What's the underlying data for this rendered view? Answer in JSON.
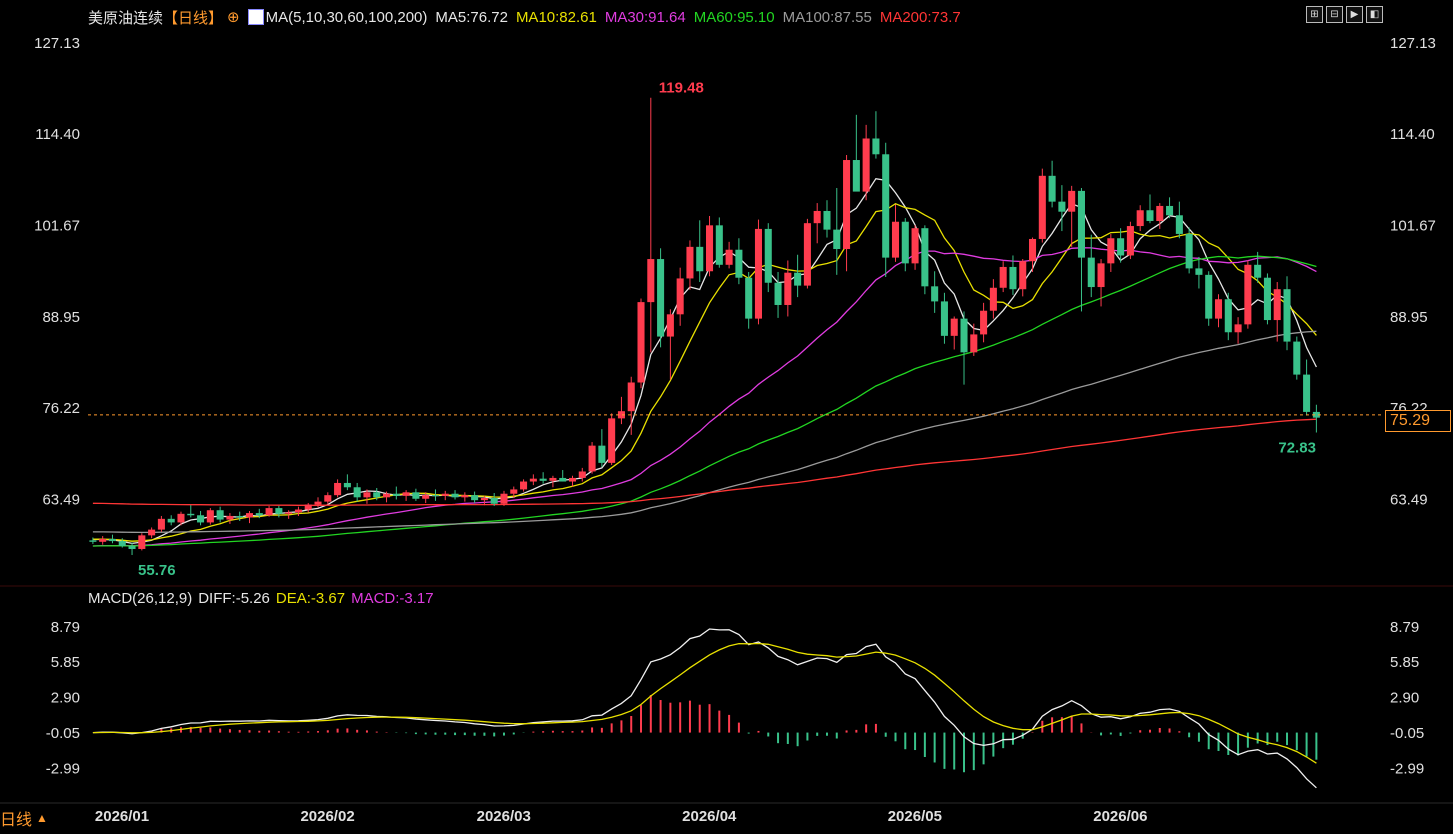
{
  "header": {
    "instrument": "美原油连续",
    "period_tag": "【日线】",
    "ma_params": "MA(5,10,30,60,100,200)",
    "ma_values": [
      {
        "text": "MA5:76.72",
        "color": "#e6e6e6"
      },
      {
        "text": "MA10:82.61",
        "color": "#e8e000"
      },
      {
        "text": "MA30:91.64",
        "color": "#e03ce0"
      },
      {
        "text": "MA60:95.10",
        "color": "#22d522"
      },
      {
        "text": "MA100:87.55",
        "color": "#9a9a9a"
      },
      {
        "text": "MA200:73.7",
        "color": "#ff3535"
      }
    ],
    "tools": [
      "⊞",
      "⊟",
      "▶",
      "◧"
    ]
  },
  "macd_header": {
    "params": "MACD(26,12,9)",
    "diff": "DIFF:-5.26",
    "dea": "DEA:-3.67",
    "macd": "MACD:-3.17"
  },
  "footer": {
    "period": "日线",
    "arrow": "▲"
  },
  "last_price": "75.29",
  "colors": {
    "up": "#ff3c4e",
    "down": "#39c28a",
    "ma5": "#e6e6e6",
    "ma10": "#e8e000",
    "ma30": "#e03ce0",
    "ma60": "#22d522",
    "ma100": "#9a9a9a",
    "ma200": "#ff3535",
    "axis": "#e0e0e0",
    "dash": "#ff9a2e"
  },
  "chart_data": [
    {
      "type": "candlestick",
      "title": "美原油连续",
      "price_ticks": [
        "127.13",
        "114.40",
        "101.67",
        "88.95",
        "76.22",
        "63.49"
      ],
      "ylim": [
        52.0,
        128.5
      ],
      "x_labels": [
        "2026/01",
        "2026/02",
        "2026/03",
        "2026/04",
        "2026/05",
        "2026/06"
      ],
      "annotations": {
        "high": "119.48",
        "low_early": "55.76",
        "low_late": "72.83"
      },
      "last_price": 75.29,
      "num_bars": 126,
      "candles_ohlc": [
        [
          57.8,
          58.2,
          57.3,
          57.6
        ],
        [
          57.6,
          58.4,
          57.2,
          58.0
        ],
        [
          58.0,
          58.6,
          57.4,
          57.7
        ],
        [
          57.7,
          58.1,
          56.8,
          57.0
        ],
        [
          57.0,
          57.5,
          55.76,
          56.6
        ],
        [
          56.6,
          58.8,
          56.4,
          58.5
        ],
        [
          58.5,
          59.6,
          58.1,
          59.3
        ],
        [
          59.3,
          61.2,
          59.0,
          60.8
        ],
        [
          60.8,
          61.3,
          59.9,
          60.3
        ],
        [
          60.3,
          61.8,
          59.9,
          61.5
        ],
        [
          61.5,
          62.7,
          61.0,
          61.3
        ],
        [
          61.3,
          61.9,
          59.9,
          60.3
        ],
        [
          60.3,
          62.3,
          60.0,
          62.0
        ],
        [
          62.0,
          62.5,
          60.3,
          60.7
        ],
        [
          60.7,
          61.6,
          60.1,
          61.2
        ],
        [
          61.2,
          61.8,
          60.5,
          61.0
        ],
        [
          61.0,
          61.9,
          60.2,
          61.6
        ],
        [
          61.6,
          62.2,
          60.9,
          61.3
        ],
        [
          61.3,
          62.6,
          61.1,
          62.3
        ],
        [
          62.3,
          62.6,
          61.0,
          61.5
        ],
        [
          61.5,
          62.0,
          60.8,
          61.7
        ],
        [
          61.7,
          62.5,
          61.2,
          62.1
        ],
        [
          62.1,
          63.0,
          61.7,
          62.8
        ],
        [
          62.8,
          63.8,
          62.4,
          63.2
        ],
        [
          63.2,
          64.5,
          62.9,
          64.1
        ],
        [
          64.1,
          66.3,
          63.8,
          65.8
        ],
        [
          65.8,
          67.0,
          64.8,
          65.2
        ],
        [
          65.2,
          65.8,
          63.2,
          63.8
        ],
        [
          63.8,
          64.9,
          62.9,
          64.5
        ],
        [
          64.5,
          65.1,
          63.4,
          63.8
        ],
        [
          63.8,
          64.6,
          63.1,
          64.3
        ],
        [
          64.3,
          65.3,
          63.5,
          64.0
        ],
        [
          64.0,
          64.8,
          63.3,
          64.5
        ],
        [
          64.5,
          65.0,
          63.3,
          63.6
        ],
        [
          63.6,
          64.5,
          63.0,
          64.1
        ],
        [
          64.1,
          64.9,
          63.3,
          64.0
        ],
        [
          64.0,
          64.7,
          63.4,
          64.3
        ],
        [
          64.3,
          64.8,
          63.5,
          63.8
        ],
        [
          63.8,
          64.5,
          63.2,
          64.1
        ],
        [
          64.1,
          64.6,
          63.0,
          63.4
        ],
        [
          63.4,
          64.0,
          62.7,
          63.7
        ],
        [
          63.7,
          64.4,
          62.6,
          62.9
        ],
        [
          62.9,
          64.7,
          62.6,
          64.3
        ],
        [
          64.3,
          65.3,
          63.7,
          64.9
        ],
        [
          64.9,
          66.3,
          64.6,
          66.0
        ],
        [
          66.0,
          67.0,
          65.5,
          66.4
        ],
        [
          66.4,
          67.3,
          65.7,
          66.1
        ],
        [
          66.1,
          66.8,
          65.2,
          66.5
        ],
        [
          66.5,
          67.6,
          66.0,
          66.0
        ],
        [
          66.0,
          66.8,
          65.3,
          66.5
        ],
        [
          66.5,
          67.9,
          66.0,
          67.4
        ],
        [
          67.4,
          71.5,
          67.1,
          71.0
        ],
        [
          71.0,
          73.3,
          68.0,
          68.6
        ],
        [
          68.6,
          75.5,
          68.3,
          74.8
        ],
        [
          74.8,
          77.8,
          74.0,
          75.8
        ],
        [
          75.8,
          80.6,
          72.5,
          79.8
        ],
        [
          79.8,
          91.5,
          79.0,
          91.0
        ],
        [
          91.0,
          119.48,
          84.0,
          97.0
        ],
        [
          97.0,
          98.5,
          84.7,
          86.2
        ],
        [
          86.2,
          90.0,
          80.2,
          89.3
        ],
        [
          89.3,
          95.8,
          87.7,
          94.3
        ],
        [
          94.3,
          99.6,
          92.7,
          98.7
        ],
        [
          98.7,
          102.4,
          93.8,
          95.3
        ],
        [
          95.3,
          103.0,
          94.6,
          101.7
        ],
        [
          101.7,
          102.8,
          95.8,
          96.2
        ],
        [
          96.2,
          99.4,
          95.7,
          98.3
        ],
        [
          98.3,
          99.9,
          93.5,
          94.4
        ],
        [
          94.4,
          95.2,
          87.3,
          88.7
        ],
        [
          88.7,
          102.5,
          87.9,
          101.2
        ],
        [
          101.2,
          102.0,
          92.4,
          93.7
        ],
        [
          93.7,
          95.2,
          88.8,
          90.6
        ],
        [
          90.6,
          96.8,
          89.0,
          95.1
        ],
        [
          95.1,
          97.6,
          91.7,
          93.3
        ],
        [
          93.3,
          102.6,
          92.9,
          102.0
        ],
        [
          102.0,
          104.8,
          99.2,
          103.7
        ],
        [
          103.7,
          105.2,
          100.0,
          101.1
        ],
        [
          101.1,
          106.9,
          94.8,
          98.4
        ],
        [
          98.4,
          111.5,
          95.3,
          110.8
        ],
        [
          110.8,
          117.1,
          108.0,
          106.4
        ],
        [
          106.4,
          115.7,
          105.2,
          113.8
        ],
        [
          113.8,
          117.6,
          111.0,
          111.6
        ],
        [
          111.6,
          113.2,
          94.5,
          97.2
        ],
        [
          97.2,
          104.6,
          96.6,
          102.2
        ],
        [
          102.2,
          102.7,
          95.3,
          96.4
        ],
        [
          96.4,
          101.7,
          95.5,
          101.3
        ],
        [
          101.3,
          101.7,
          92.1,
          93.2
        ],
        [
          93.2,
          95.3,
          89.5,
          91.1
        ],
        [
          91.1,
          92.3,
          85.2,
          86.3
        ],
        [
          86.3,
          89.0,
          84.4,
          88.7
        ],
        [
          88.7,
          89.7,
          79.5,
          84.0
        ],
        [
          84.0,
          88.0,
          83.5,
          86.5
        ],
        [
          86.5,
          90.9,
          85.4,
          89.8
        ],
        [
          89.8,
          94.2,
          88.7,
          93.0
        ],
        [
          93.0,
          96.7,
          92.4,
          95.9
        ],
        [
          95.9,
          97.5,
          92.0,
          92.8
        ],
        [
          92.8,
          97.0,
          91.8,
          96.7
        ],
        [
          96.7,
          100.0,
          95.2,
          99.8
        ],
        [
          99.8,
          109.6,
          99.3,
          108.6
        ],
        [
          108.6,
          110.7,
          104.2,
          105.0
        ],
        [
          105.0,
          107.3,
          100.9,
          103.6
        ],
        [
          103.6,
          107.2,
          98.7,
          106.5
        ],
        [
          106.5,
          106.9,
          89.7,
          97.2
        ],
        [
          97.2,
          100.4,
          91.7,
          93.1
        ],
        [
          93.1,
          97.0,
          90.4,
          96.4
        ],
        [
          96.4,
          100.5,
          95.2,
          99.9
        ],
        [
          99.9,
          101.3,
          96.5,
          97.5
        ],
        [
          97.5,
          102.2,
          97.0,
          101.6
        ],
        [
          101.6,
          104.5,
          100.9,
          103.8
        ],
        [
          103.8,
          106.0,
          102.0,
          102.3
        ],
        [
          102.3,
          104.8,
          101.2,
          104.4
        ],
        [
          104.4,
          105.6,
          102.7,
          103.1
        ],
        [
          103.1,
          105.0,
          99.9,
          100.5
        ],
        [
          100.5,
          101.4,
          95.0,
          95.7
        ],
        [
          95.7,
          97.3,
          92.9,
          94.8
        ],
        [
          94.8,
          95.3,
          87.7,
          88.7
        ],
        [
          88.7,
          92.1,
          87.5,
          91.4
        ],
        [
          91.4,
          92.3,
          85.7,
          86.8
        ],
        [
          86.8,
          88.9,
          85.2,
          87.9
        ],
        [
          87.9,
          96.8,
          87.3,
          96.2
        ],
        [
          96.2,
          98.0,
          93.7,
          94.4
        ],
        [
          94.4,
          95.0,
          87.9,
          88.5
        ],
        [
          88.5,
          93.8,
          85.5,
          92.8
        ],
        [
          92.8,
          94.6,
          84.3,
          85.5
        ],
        [
          85.5,
          86.2,
          80.2,
          80.9
        ],
        [
          80.9,
          83.0,
          75.2,
          75.7
        ],
        [
          75.7,
          76.7,
          72.83,
          74.9
        ]
      ]
    },
    {
      "type": "macd",
      "title": "MACD(26,12,9)",
      "ticks": [
        "8.79",
        "5.85",
        "2.90",
        "-0.05",
        "-2.99"
      ],
      "ylim": [
        -5.6,
        9.6
      ],
      "diff": -5.26,
      "dea": -3.67,
      "macd": -3.17
    }
  ]
}
